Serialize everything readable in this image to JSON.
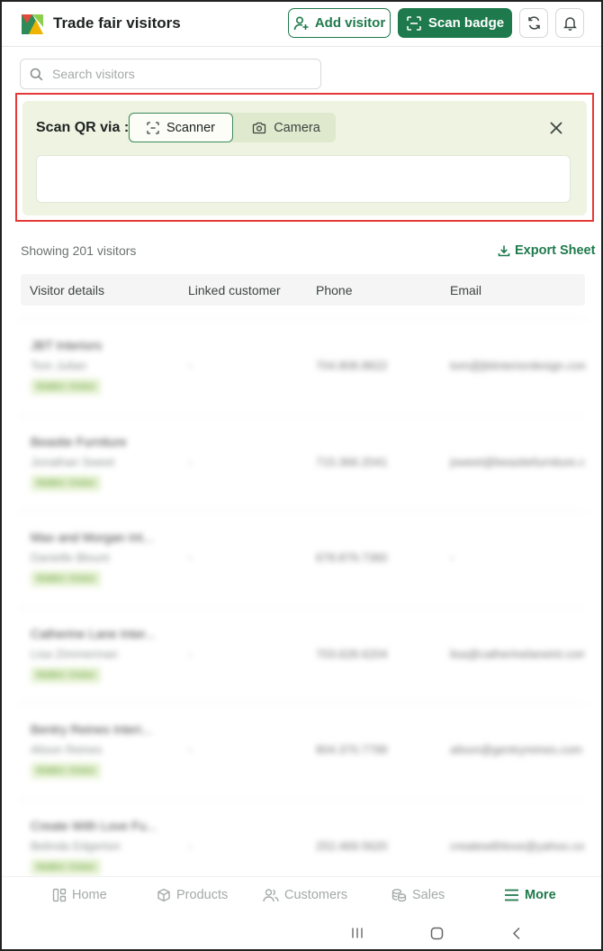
{
  "header": {
    "title": "Trade fair visitors",
    "add_visitor_label": "Add visitor",
    "scan_badge_label": "Scan badge"
  },
  "search": {
    "placeholder": "Search visitors"
  },
  "scan_panel": {
    "label": "Scan QR via :",
    "options": [
      "Scanner",
      "Camera"
    ],
    "selected": "Scanner"
  },
  "results": {
    "showing_text": "Showing 201 visitors",
    "export_label": "Export Sheet",
    "columns": [
      "Visitor details",
      "Linked customer",
      "Phone",
      "Email"
    ],
    "rows": [
      {
        "company": "JBT Interiors",
        "person": "Tom Julian",
        "badge": "Walkin Visitor",
        "linked": "-",
        "phone": "704.808.8822",
        "email": "tom@jbtinteriordesign.com"
      },
      {
        "company": "Beastie Furniture",
        "person": "Jonathan Sweet",
        "badge": "Walkin Visitor",
        "linked": "-",
        "phone": "715.366.2041",
        "email": "jsweet@beastiefurniture.com"
      },
      {
        "company": "Max and Morgan Int...",
        "person": "Danielle Blount",
        "badge": "Walkin Visitor",
        "linked": "-",
        "phone": "678.879.7360",
        "email": "-"
      },
      {
        "company": "Catherine Lane Inter...",
        "person": "Lisa Zimmerman",
        "badge": "Walkin Visitor",
        "linked": "-",
        "phone": "703.628.6204",
        "email": "lisa@catherinelaneint.com"
      },
      {
        "company": "Bentry Reines Interi...",
        "person": "Alison Reines",
        "badge": "Walkin Visitor",
        "linked": "-",
        "phone": "804.370.7799",
        "email": "alison@gentryreines.com"
      },
      {
        "company": "Create With Love Fu...",
        "person": "Belinda Edgerton",
        "badge": "Walkin Visitor",
        "linked": "-",
        "phone": "252.469.5620",
        "email": "createwithlove@yahoo.com"
      }
    ]
  },
  "bottom_nav": {
    "items": [
      {
        "label": "Home",
        "icon": "home-icon"
      },
      {
        "label": "Products",
        "icon": "box-icon"
      },
      {
        "label": "Customers",
        "icon": "users-icon"
      },
      {
        "label": "Sales",
        "icon": "coins-icon"
      },
      {
        "label": "More",
        "icon": "menu-icon"
      }
    ],
    "active": "More"
  },
  "colors": {
    "brand": "#1e7a4c",
    "panel_bg": "#eef3e2",
    "highlight_border": "#e53935"
  }
}
